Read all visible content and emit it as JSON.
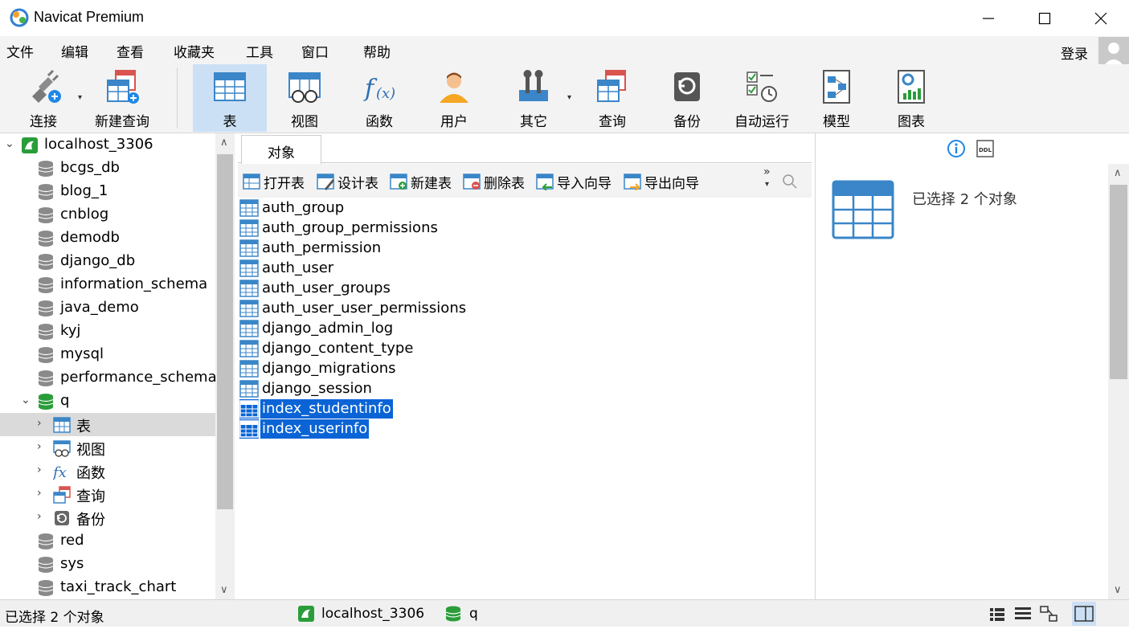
{
  "app": {
    "title": "Navicat Premium"
  },
  "menu": [
    "文件",
    "编辑",
    "查看",
    "收藏夹",
    "工具",
    "窗口",
    "帮助"
  ],
  "account": {
    "login_label": "登录"
  },
  "toolbar": {
    "connect": "连接",
    "new_query": "新建查询",
    "table": "表",
    "view": "视图",
    "function": "函数",
    "user": "用户",
    "other": "其它",
    "query": "查询",
    "backup": "备份",
    "autorun": "自动运行",
    "model": "模型",
    "chart": "图表"
  },
  "sidebar": {
    "connection": "localhost_3306",
    "databases_top": [
      "bcgs_db",
      "blog_1",
      "cnblog",
      "demodb",
      "django_db",
      "information_schema",
      "java_demo",
      "kyj",
      "mysql",
      "performance_schema"
    ],
    "open_db": "q",
    "open_db_children": [
      "表",
      "视图",
      "函数",
      "查询",
      "备份"
    ],
    "databases_bottom": [
      "red",
      "sys",
      "taxi_track_chart"
    ]
  },
  "main": {
    "tab_label": "对象",
    "actions": {
      "open": "打开表",
      "design": "设计表",
      "new": "新建表",
      "delete": "删除表",
      "import": "导入向导",
      "export": "导出向导"
    },
    "tables": [
      "auth_group",
      "auth_group_permissions",
      "auth_permission",
      "auth_user",
      "auth_user_groups",
      "auth_user_user_permissions",
      "django_admin_log",
      "django_content_type",
      "django_migrations",
      "django_session",
      "index_studentinfo",
      "index_userinfo"
    ],
    "selected": [
      "index_studentinfo",
      "index_userinfo"
    ]
  },
  "right_panel": {
    "selection_text": "已选择 2 个对象"
  },
  "status": {
    "selection": "已选择 2 个对象",
    "connection": "localhost_3306",
    "database": "q"
  },
  "colors": {
    "accent": "#0a64d6",
    "active_tool": "#cce0f5",
    "db_green": "#2a9d3a",
    "table_blue": "#3a86c8"
  }
}
